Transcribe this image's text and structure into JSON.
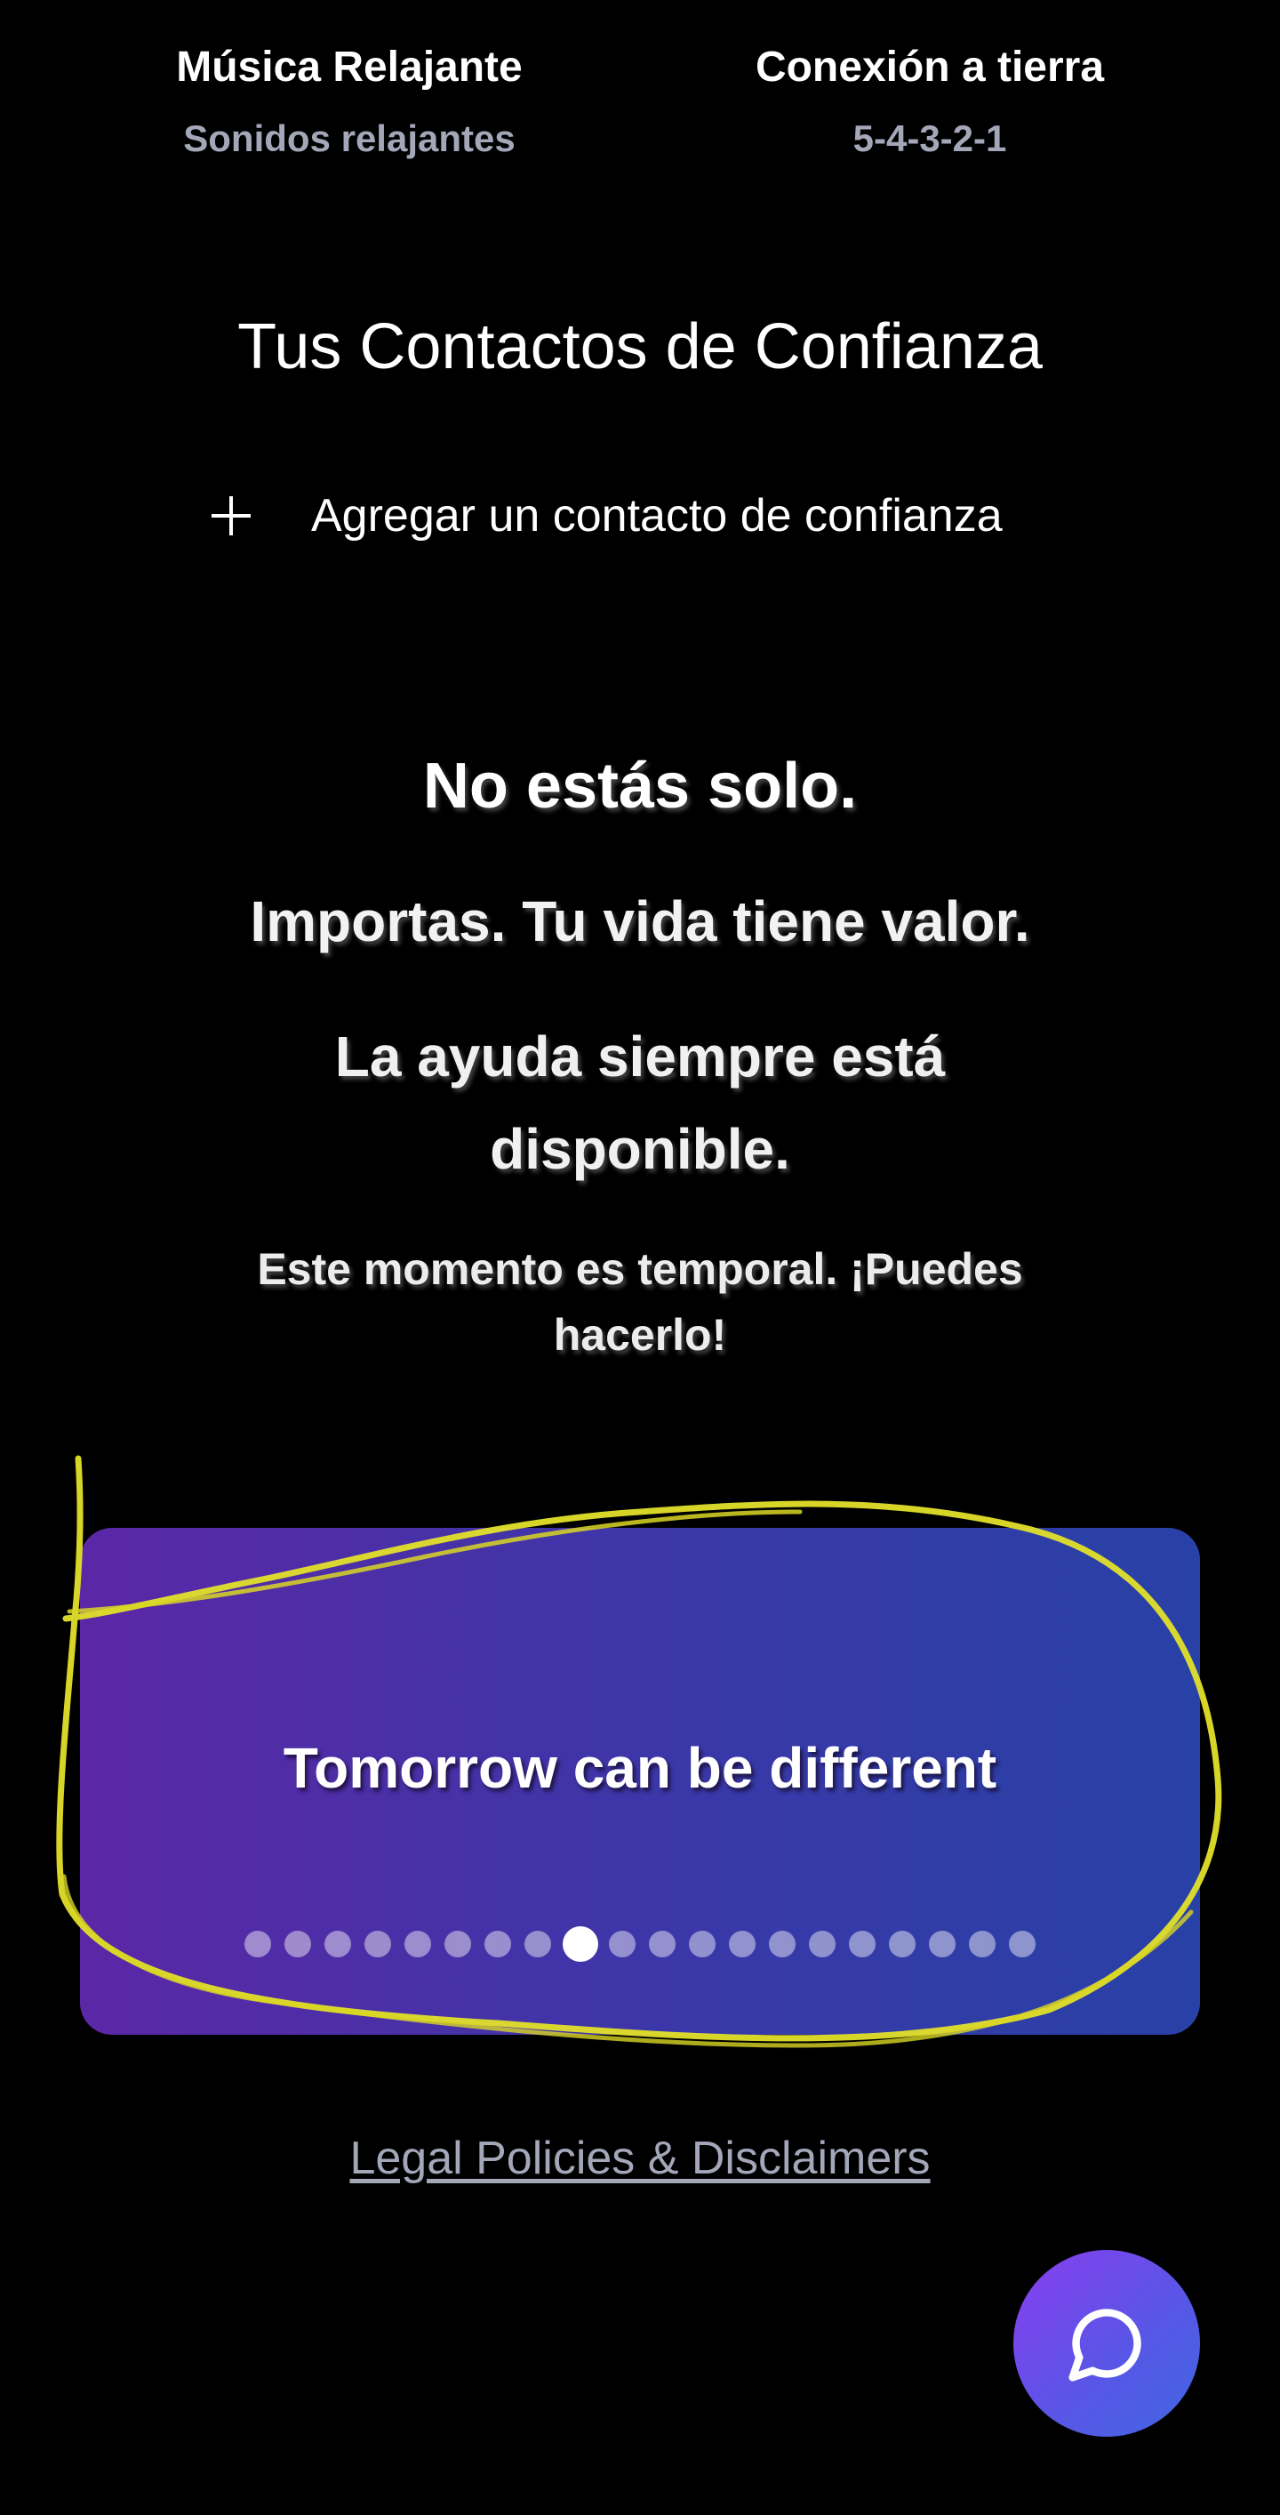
{
  "tools": [
    {
      "title": "Música Relajante",
      "subtitle": "Sonidos relajantes"
    },
    {
      "title": "Conexión a tierra",
      "subtitle": "5-4-3-2-1"
    }
  ],
  "contacts": {
    "title": "Tus Contactos de Confianza",
    "add_label": "Agregar un contacto de confianza",
    "add_icon": "plus-icon"
  },
  "messages": {
    "line1": "No estás solo.",
    "line2": "Importas. Tu vida tiene valor.",
    "line3": "La ayuda siempre está disponible.",
    "line4": "Este momento es temporal. ¡Puedes hacerlo!"
  },
  "carousel": {
    "text": "Tomorrow can be different",
    "slide_count": 20,
    "active_index": 8,
    "gradient_start": "#5b27a6",
    "gradient_end": "#2841a6"
  },
  "legal_link": "Legal Policies & Disclaimers",
  "chat_button": {
    "icon": "chat-bubble-icon",
    "color_start": "#8a3ef0",
    "color_end": "#3f67e2"
  },
  "annotation": {
    "type": "hand-drawn yellow circle",
    "color": "#e3e02a"
  }
}
